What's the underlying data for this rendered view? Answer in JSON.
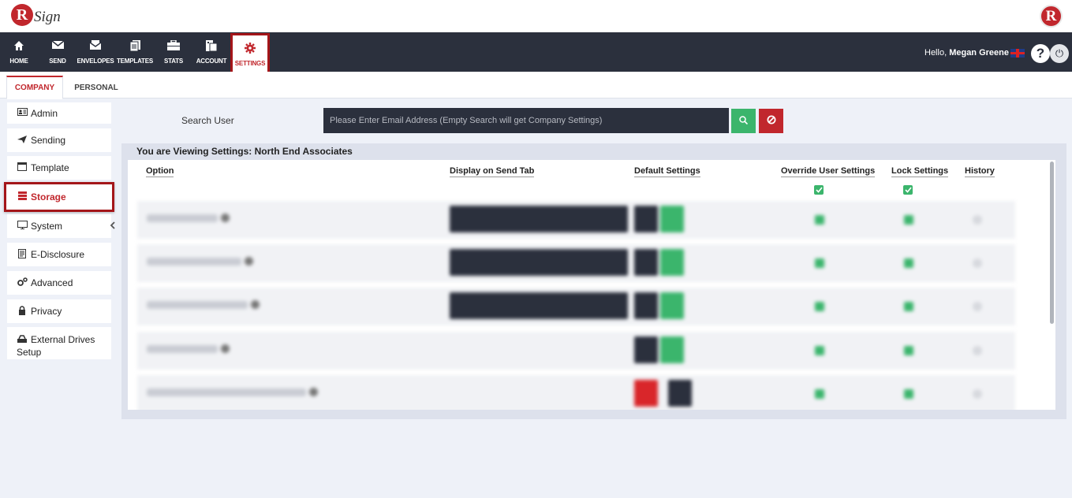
{
  "header": {
    "logo_letter": "R",
    "logo_text": "Sign",
    "right_logo_letter": "R"
  },
  "nav": {
    "items": [
      {
        "label": "HOME",
        "icon": "home-icon"
      },
      {
        "label": "SEND",
        "icon": "envelope-icon"
      },
      {
        "label": "ENVELOPES",
        "icon": "envelopes-icon"
      },
      {
        "label": "TEMPLATES",
        "icon": "templates-icon"
      },
      {
        "label": "STATS",
        "icon": "briefcase-icon"
      },
      {
        "label": "ACCOUNT",
        "icon": "account-icon"
      },
      {
        "label": "SETTINGS",
        "icon": "gear-icon"
      }
    ],
    "greeting_prefix": "Hello,",
    "user_name": "Megan Greene",
    "help_label": "?",
    "power_label": "⏻"
  },
  "tabs": {
    "company": "COMPANY",
    "personal": "PERSONAL"
  },
  "sidebar": {
    "items": [
      {
        "label": "Admin",
        "icon": "admin-card-icon"
      },
      {
        "label": "Sending",
        "icon": "paper-plane-icon"
      },
      {
        "label": "Template",
        "icon": "template-window-icon"
      },
      {
        "label": "Storage",
        "icon": "storage-database-icon"
      },
      {
        "label": "System",
        "icon": "monitor-icon"
      },
      {
        "label": "E-Disclosure",
        "icon": "document-icon"
      },
      {
        "label": "Advanced",
        "icon": "cogs-icon"
      },
      {
        "label": "Privacy",
        "icon": "lock-icon"
      },
      {
        "label": "External Drives Setup",
        "icon": "drive-icon"
      }
    ],
    "active": "Storage"
  },
  "search": {
    "label": "Search User",
    "placeholder": "Please Enter Email Address (Empty Search will get Company Settings)",
    "value": ""
  },
  "panel": {
    "title": "You are Viewing Settings: North End Associates",
    "columns": {
      "option": "Option",
      "display": "Display on Send Tab",
      "default": "Default Settings",
      "override": "Override User Settings",
      "lock": "Lock Settings",
      "history": "History"
    },
    "override_all_checked": true,
    "lock_all_checked": true
  },
  "colors": {
    "brand_red": "#c1272d",
    "nav_dark": "#2b303d",
    "success_green": "#3bb56c",
    "page_bg": "#eef1f8"
  }
}
